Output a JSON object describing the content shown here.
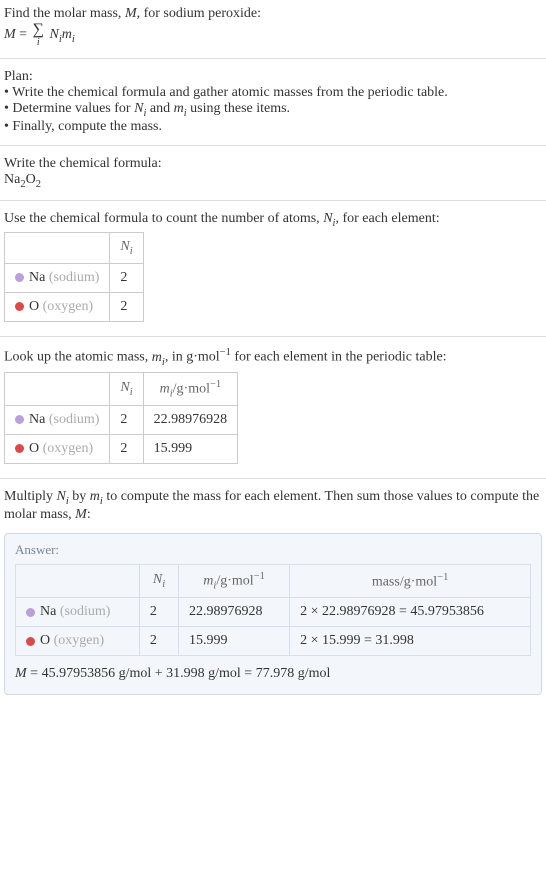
{
  "intro": {
    "line1": "Find the molar mass, M, for sodium peroxide:",
    "formula_lhs": "M",
    "formula_rhs": "N_i m_i"
  },
  "plan": {
    "title": "Plan:",
    "b1": "Write the chemical formula and gather atomic masses from the periodic table.",
    "b2_a": "Determine values for ",
    "b2_b": " and ",
    "b2_c": " using these items.",
    "b3": "Finally, compute the mass."
  },
  "step_formula": {
    "title": "Write the chemical formula:",
    "na": "Na",
    "na_n": "2",
    "o": "O",
    "o_n": "2"
  },
  "step_count": {
    "title_a": "Use the chemical formula to count the number of atoms, ",
    "title_b": ", for each element:",
    "h_n": "N",
    "rows": [
      {
        "dot": "#b9a0d9",
        "sym": "Na",
        "name": "(sodium)",
        "n": "2"
      },
      {
        "dot": "#d94a4a",
        "sym": "O",
        "name": "(oxygen)",
        "n": "2"
      }
    ]
  },
  "step_mass": {
    "title_a": "Look up the atomic mass, ",
    "title_b": ", in g·mol",
    "title_c": " for each element in the periodic table:",
    "h_n": "N",
    "h_m": "m",
    "h_unit": "/g·mol",
    "rows": [
      {
        "dot": "#b9a0d9",
        "sym": "Na",
        "name": "(sodium)",
        "n": "2",
        "m": "22.98976928"
      },
      {
        "dot": "#d94a4a",
        "sym": "O",
        "name": "(oxygen)",
        "n": "2",
        "m": "15.999"
      }
    ]
  },
  "step_mult": {
    "text_a": "Multiply ",
    "text_b": " by ",
    "text_c": " to compute the mass for each element. Then sum those values to compute the molar mass, ",
    "text_d": ":"
  },
  "answer": {
    "label": "Answer:",
    "h_n": "N",
    "h_m": "m",
    "h_unit": "/g·mol",
    "h_mass": "mass/g·mol",
    "rows": [
      {
        "dot": "#b9a0d9",
        "sym": "Na",
        "name": "(sodium)",
        "n": "2",
        "m": "22.98976928",
        "mass": "2 × 22.98976928 = 45.97953856"
      },
      {
        "dot": "#d94a4a",
        "sym": "O",
        "name": "(oxygen)",
        "n": "2",
        "m": "15.999",
        "mass": "2 × 15.999 = 31.998"
      }
    ],
    "final": "M = 45.97953856 g/mol + 31.998 g/mol = 77.978 g/mol"
  },
  "sym": {
    "Ni": "N",
    "mi": "m",
    "i": "i",
    "M": "M",
    "neg1": "−1"
  }
}
